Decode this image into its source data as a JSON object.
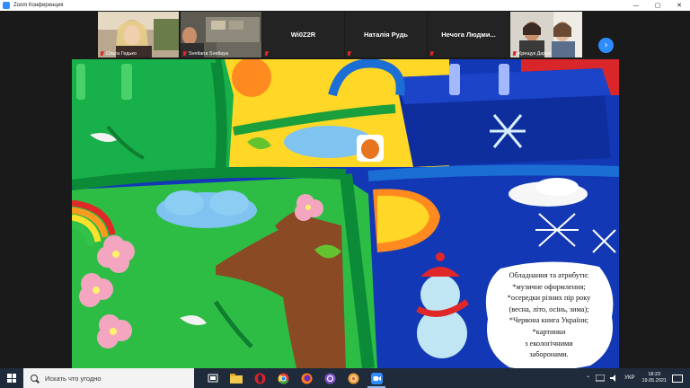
{
  "window": {
    "title": "Zoom Конференция"
  },
  "participants": [
    {
      "name": "Ольга Гедько",
      "video": true
    },
    {
      "name": "Svetlana Svetlaya",
      "video": true
    },
    {
      "name": "Wi0Z2R",
      "video": false
    },
    {
      "name": "Наталія Рудь",
      "video": false
    },
    {
      "name": "Нечога  Людми...",
      "video": false
    },
    {
      "name": "Крещук Дарья",
      "video": true
    }
  ],
  "shared_note": {
    "lines": [
      "Обладнання  та атрибути:",
      "*музичне оформлення;",
      "*осередки різних пір року",
      "(весна, літо, осінь, зима);",
      "*Червона книга України;",
      "*картинки",
      "з екологічними",
      "заборонами."
    ]
  },
  "taskbar": {
    "search_placeholder": "Искать что угодно",
    "language": "УКР",
    "time": "18:23",
    "date": "19.05.2021"
  },
  "colors": {
    "zoom_blue": "#2d8cff",
    "mic_muted": "#e02828",
    "taskbar": "#1f2a3a"
  }
}
